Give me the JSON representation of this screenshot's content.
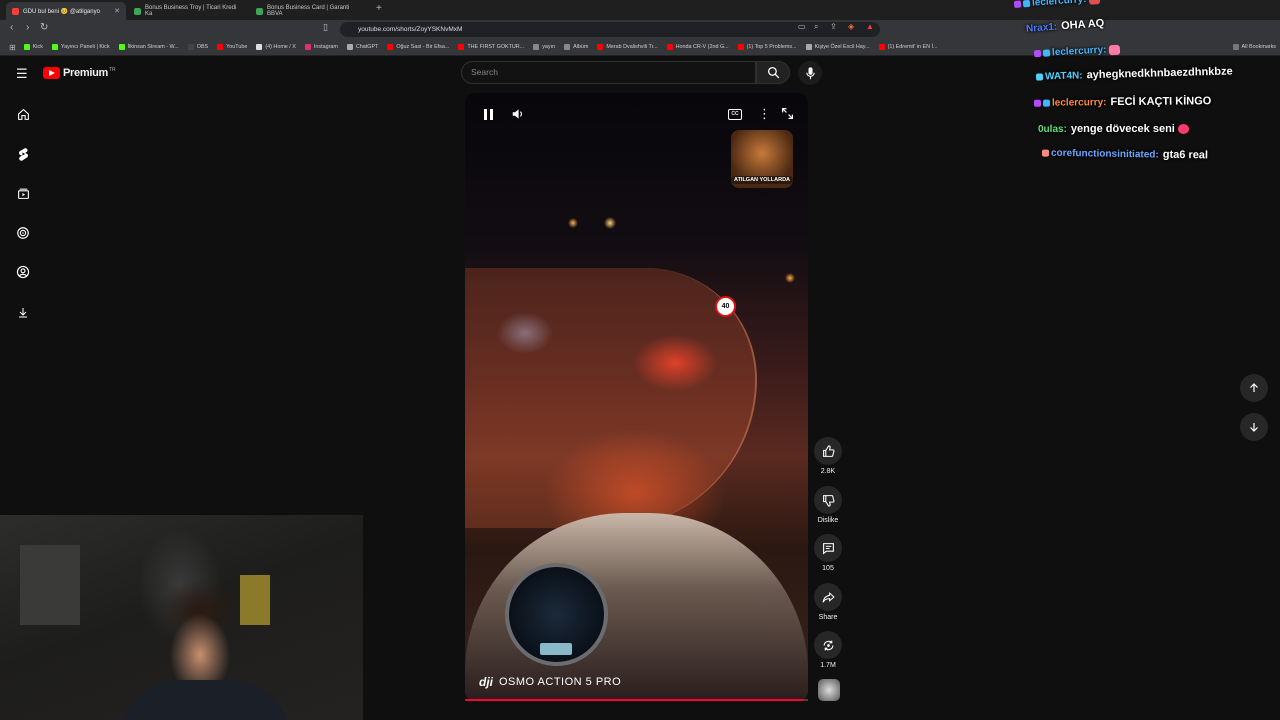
{
  "browser": {
    "tabs": [
      {
        "title": "GDU bul beni 🥺 @atilganyo",
        "favicon_color": "#ff3b3b",
        "active": true
      },
      {
        "title": "Bonus Business Troy | Ticari Kredi Ka",
        "favicon_color": "#3aa857",
        "active": false
      },
      {
        "title": "Bonus Business Card | Garanti BBVA",
        "favicon_color": "#3aa857",
        "active": false
      }
    ],
    "new_tab": "+",
    "url": "youtube.com/shorts/ZoyYSKNvMxM",
    "bookmarks": [
      {
        "label": "Kick",
        "color": "#53fc18"
      },
      {
        "label": "Yayıncı Paneli | Kick",
        "color": "#53fc18"
      },
      {
        "label": "İlkinsan Stream - W...",
        "color": "#53fc18"
      },
      {
        "label": "OBS",
        "color": "#444"
      },
      {
        "label": "YouTube",
        "color": "#ff0000"
      },
      {
        "label": "(4) Home / X",
        "color": "#ddd"
      },
      {
        "label": "Instagram",
        "color": "#e1306c"
      },
      {
        "label": "ChatGPT",
        "color": "#aaa"
      },
      {
        "label": "Oğuz Sasi - Bir Efsa...",
        "color": "#ff0000"
      },
      {
        "label": "THE FIRST GOKTUR...",
        "color": "#ff0000"
      },
      {
        "label": "yayın",
        "color": "#888"
      },
      {
        "label": "Albüm",
        "color": "#888"
      },
      {
        "label": "Merab Dvalishvili Tr...",
        "color": "#ff0000"
      },
      {
        "label": "Honda CR-V (2nd G...",
        "color": "#ff0000"
      },
      {
        "label": "(1) Top 5 Problems...",
        "color": "#ff0000"
      },
      {
        "label": "Kişiye Özel Excil Hay...",
        "color": "#aaa"
      },
      {
        "label": "(1) Edremit' in EN İ...",
        "color": "#ff0000"
      }
    ],
    "all_bookmarks": "All Bookmarks"
  },
  "youtube": {
    "brand": "Premium",
    "region": "TR",
    "search_placeholder": "Search",
    "sidebar_icons": [
      "home-icon",
      "shorts-icon",
      "subscriptions-icon",
      "your-channel-icon",
      "account-icon",
      "downloads-icon"
    ]
  },
  "video": {
    "channel_badge": "ATILGAN YOLLARDA",
    "speed_sign": "40",
    "camera_brand": "dji",
    "camera_model": "OSMO ACTION 5 PRO",
    "progress": 0.985
  },
  "actions": {
    "like_count": "2.8K",
    "dislike_label": "Dislike",
    "comment_count": "105",
    "share_label": "Share",
    "remix_count": "1.7M"
  },
  "chat": [
    {
      "user": "leclercurry:",
      "message": "",
      "user_color": "#3fb8ff"
    },
    {
      "user": "Nrax1:",
      "message": "OHA AQ",
      "user_color": "#4d7cff"
    },
    {
      "user": "leclercurry:",
      "message": "",
      "user_color": "#3fb8ff"
    },
    {
      "user": "WAT4N:",
      "message": "ayhegknedkhnbaezdhnkbze",
      "user_color": "#4fd0ff"
    },
    {
      "user": "leclercurry:",
      "message": "FECİ KAÇTI KİNGO",
      "user_color": "#ff8a3d"
    },
    {
      "user": "0ulas:",
      "message": "yenge dövecek seni",
      "user_color": "#5be07a"
    },
    {
      "user": "corefunctionsinitiated:",
      "message": "gta6 real",
      "user_color": "#6aa8ff"
    }
  ]
}
